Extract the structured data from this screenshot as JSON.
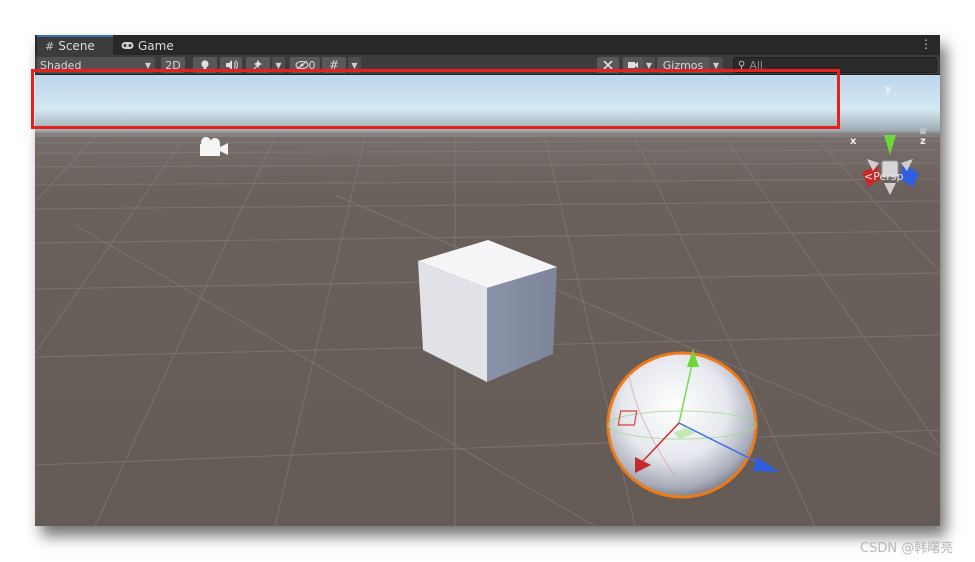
{
  "tabs": [
    {
      "label": "Scene",
      "icon": "grid-icon",
      "active": true
    },
    {
      "label": "Game",
      "icon": "gamepad-icon",
      "active": false
    }
  ],
  "toolbar": {
    "shading_mode": "Shaded",
    "mode_2d": "2D",
    "hidden_count": "0",
    "gizmos": "Gizmos",
    "search_placeholder": "All"
  },
  "scene_gizmo": {
    "axis_x": "x",
    "axis_y": "y",
    "axis_z": "z",
    "projection": "Persp"
  },
  "watermark": "CSDN @韩曙亮",
  "colors": {
    "highlight": "#e8201c",
    "axis_x": "#c42a2a",
    "axis_y": "#6ed53a",
    "axis_z": "#2f5fe0",
    "selection_outline": "#ef7a1a"
  }
}
